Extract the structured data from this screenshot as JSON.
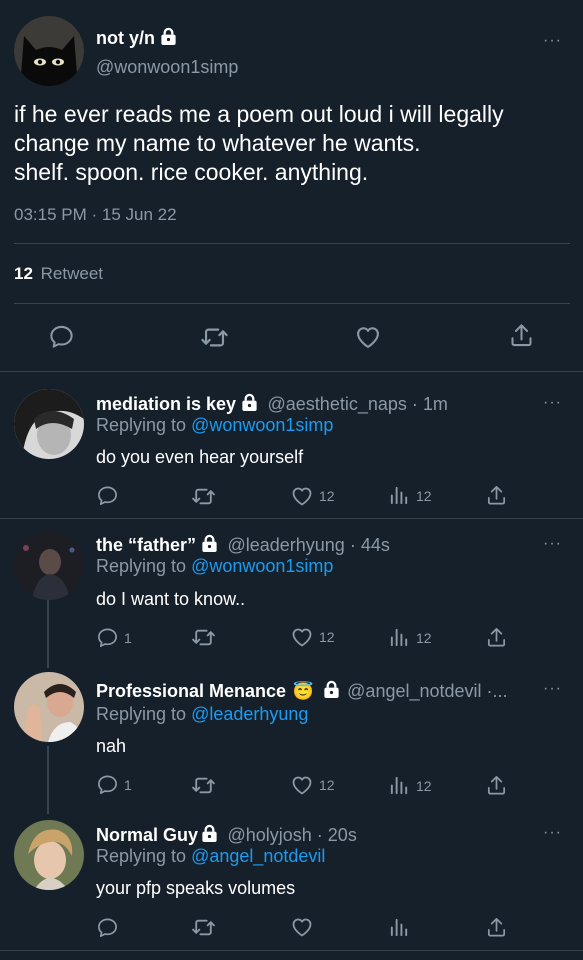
{
  "main_tweet": {
    "name": "not y/n",
    "handle": "@wonwoon1simp",
    "text_lines": [
      "if he ever reads me a poem out loud i will legally",
      "change my name to whatever he wants.",
      "shelf. spoon. rice cooker. anything."
    ],
    "timestamp": "03:15 PM · 15 Jun 22",
    "retweet_count": "12",
    "retweet_label": "Retweet"
  },
  "replies": [
    {
      "name": "mediation is key",
      "meta": "@aesthetic_naps · 1m",
      "replying_prefix": "Replying to ",
      "replying_to": "@wonwoon1simp",
      "text": "do you even hear yourself",
      "reply_count": "",
      "like_count": "12",
      "view_count": "12"
    },
    {
      "name": "the “father”",
      "meta": "@leaderhyung · 44s",
      "replying_prefix": "Replying to ",
      "replying_to": "@wonwoon1simp",
      "text": "do I want to know..",
      "reply_count": "1",
      "like_count": "12",
      "view_count": "12"
    },
    {
      "name": "Professional Menance",
      "emoji": "😇",
      "meta": "@angel_notdevil ·...",
      "replying_prefix": "Replying to ",
      "replying_to": "@leaderhyung",
      "text": "nah",
      "reply_count": "1",
      "like_count": "12",
      "view_count": "12"
    },
    {
      "name": "Normal Guy",
      "meta": "@holyjosh · 20s",
      "replying_prefix": "Replying to ",
      "replying_to": "@angel_notdevil",
      "text": "your pfp speaks volumes",
      "reply_count": "",
      "like_count": "",
      "view_count": ""
    }
  ],
  "more_label": "···",
  "colors": {
    "background": "#15202b",
    "muted": "#8b98a5",
    "link": "#1d9bf0",
    "divider": "#38444d"
  },
  "icons": [
    "lock-icon",
    "more-icon",
    "reply-icon",
    "retweet-icon",
    "like-icon",
    "views-icon",
    "share-icon"
  ]
}
